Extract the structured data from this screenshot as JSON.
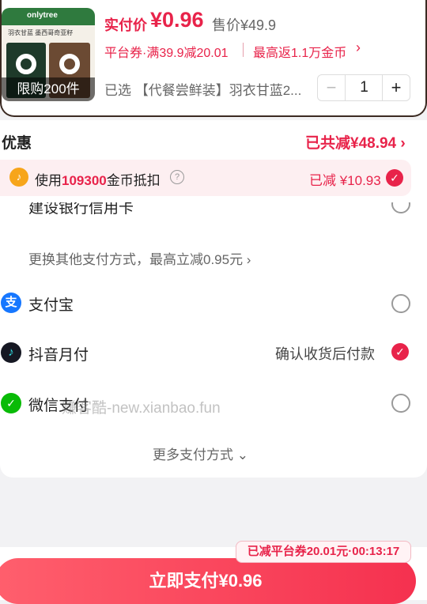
{
  "product": {
    "brand": "onlytree",
    "thumb_subtitle": "羽衣甘蓝 墨西哥奇亚籽",
    "limit_badge": "限购200件",
    "pay_label": "实付价",
    "pay_price": "¥0.96",
    "original_price": "售价¥49.9",
    "coupon": "平台券·满39.9减20.01",
    "cashback": "最高返1.1万金币",
    "selected": "已选 【代餐尝鲜装】羽衣甘蓝2...",
    "quantity": "1"
  },
  "discount": {
    "title": "优惠",
    "total": "已共减¥48.94 ›",
    "coin_prefix": "使用",
    "coin_amount": "109300",
    "coin_suffix": "金币抵扣",
    "coin_deduct": "已减 ¥10.93"
  },
  "payment": {
    "bank_card": "建设银行信用卡",
    "switch_method": "更换其他支付方式，最高立减0.95元 ›",
    "alipay": "支付宝",
    "douyin": "抖音月付",
    "douyin_note": "确认收货后付款",
    "wechat": "微信支付",
    "watermark": "赚客酷-new.xianbao.fun",
    "more": "更多支付方式 ⌄"
  },
  "footer": {
    "timer_badge": "已减平台券20.01元·00:13:17",
    "pay_button": "立即支付¥0.96"
  },
  "colors": {
    "accent": "#e8234a"
  }
}
